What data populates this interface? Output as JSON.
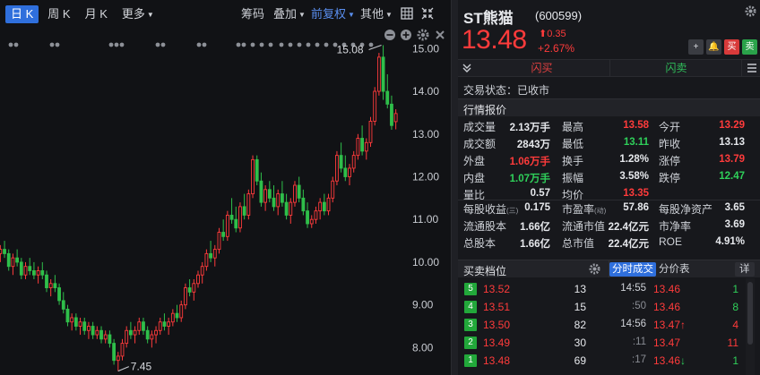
{
  "toolbar": {
    "periods": [
      {
        "label": "日 K",
        "active": true
      },
      {
        "label": "周 K",
        "active": false
      },
      {
        "label": "月 K",
        "active": false
      }
    ],
    "more": "更多",
    "chips": "筹码",
    "overlay": "叠加",
    "adjust": "前复权",
    "other": "其他",
    "icons": [
      "grid-icon",
      "collapse-icon"
    ]
  },
  "chart": {
    "price_axis": [
      "15.00",
      "14.00",
      "13.00",
      "12.00",
      "11.00",
      "10.00",
      "9.00",
      "8.00"
    ],
    "high_marker": "15.08",
    "low_marker": "7.45",
    "colors": {
      "up": "#ff3b3b",
      "down": "#2fbf4a",
      "bg": "#111215"
    },
    "controls": [
      "zoom-out-icon",
      "zoom-in-icon",
      "settings-icon",
      "close-icon"
    ]
  },
  "chart_data": {
    "type": "candlestick",
    "yrange": [
      7.4,
      15.3
    ],
    "y_ticks": [
      15.0,
      14.0,
      13.0,
      12.0,
      11.0,
      10.0,
      9.0,
      8.0
    ],
    "high": 15.08,
    "low": 7.45,
    "candles": [
      [
        10.2,
        10.4,
        10.0,
        10.3
      ],
      [
        10.3,
        10.5,
        10.1,
        10.2
      ],
      [
        10.2,
        10.3,
        9.8,
        9.9
      ],
      [
        9.9,
        10.2,
        9.7,
        10.1
      ],
      [
        10.1,
        10.3,
        9.9,
        10.0
      ],
      [
        10.0,
        10.1,
        9.6,
        9.7
      ],
      [
        9.7,
        10.0,
        9.6,
        9.9
      ],
      [
        9.9,
        10.1,
        9.7,
        9.8
      ],
      [
        9.8,
        10.0,
        9.6,
        9.7
      ],
      [
        9.7,
        9.9,
        9.5,
        9.8
      ],
      [
        9.8,
        10.0,
        9.6,
        9.7
      ],
      [
        9.7,
        9.8,
        9.3,
        9.4
      ],
      [
        9.4,
        9.6,
        9.2,
        9.5
      ],
      [
        9.5,
        9.7,
        9.3,
        9.4
      ],
      [
        9.4,
        9.5,
        9.0,
        9.1
      ],
      [
        9.1,
        9.3,
        8.8,
        8.9
      ],
      [
        8.9,
        9.0,
        8.5,
        8.6
      ],
      [
        8.6,
        8.8,
        8.4,
        8.7
      ],
      [
        8.7,
        8.8,
        8.4,
        8.5
      ],
      [
        8.5,
        8.7,
        8.3,
        8.6
      ],
      [
        8.6,
        8.7,
        8.3,
        8.4
      ],
      [
        8.4,
        8.6,
        8.2,
        8.5
      ],
      [
        8.5,
        8.6,
        8.2,
        8.3
      ],
      [
        8.3,
        8.5,
        8.2,
        8.4
      ],
      [
        8.4,
        8.5,
        8.1,
        8.2
      ],
      [
        8.2,
        8.4,
        8.1,
        8.3
      ],
      [
        8.3,
        8.4,
        8.0,
        8.1
      ],
      [
        8.1,
        8.2,
        7.6,
        7.7
      ],
      [
        7.7,
        7.9,
        7.45,
        7.8
      ],
      [
        7.8,
        8.2,
        7.7,
        8.1
      ],
      [
        8.1,
        8.5,
        8.0,
        8.4
      ],
      [
        8.4,
        8.6,
        8.2,
        8.3
      ],
      [
        8.3,
        8.5,
        8.1,
        8.4
      ],
      [
        8.4,
        8.7,
        8.3,
        8.6
      ],
      [
        8.6,
        8.7,
        8.3,
        8.4
      ],
      [
        8.4,
        8.5,
        8.1,
        8.2
      ],
      [
        8.2,
        8.4,
        8.0,
        8.3
      ],
      [
        8.3,
        8.5,
        8.1,
        8.4
      ],
      [
        8.4,
        8.7,
        8.3,
        8.6
      ],
      [
        8.6,
        8.8,
        8.4,
        8.5
      ],
      [
        8.5,
        8.7,
        8.3,
        8.6
      ],
      [
        8.6,
        8.9,
        8.5,
        8.8
      ],
      [
        8.8,
        9.0,
        8.6,
        8.7
      ],
      [
        8.7,
        9.1,
        8.6,
        9.0
      ],
      [
        9.0,
        9.5,
        8.9,
        9.4
      ],
      [
        9.4,
        9.6,
        9.2,
        9.3
      ],
      [
        9.3,
        9.6,
        9.1,
        9.5
      ],
      [
        9.5,
        9.8,
        9.4,
        9.7
      ],
      [
        9.7,
        10.0,
        9.5,
        9.9
      ],
      [
        9.9,
        10.3,
        9.8,
        10.2
      ],
      [
        10.2,
        10.5,
        10.0,
        10.1
      ],
      [
        10.1,
        10.4,
        9.9,
        10.3
      ],
      [
        10.3,
        10.8,
        10.2,
        10.7
      ],
      [
        10.7,
        11.0,
        10.5,
        10.6
      ],
      [
        10.6,
        11.2,
        10.5,
        11.1
      ],
      [
        11.1,
        11.5,
        10.9,
        11.0
      ],
      [
        11.0,
        11.3,
        10.7,
        10.8
      ],
      [
        10.8,
        11.4,
        10.7,
        11.3
      ],
      [
        11.3,
        11.6,
        11.0,
        11.1
      ],
      [
        11.1,
        11.7,
        11.0,
        11.6
      ],
      [
        11.6,
        12.5,
        11.5,
        12.4
      ],
      [
        12.4,
        12.5,
        11.8,
        11.9
      ],
      [
        11.9,
        12.1,
        11.3,
        11.4
      ],
      [
        11.4,
        11.8,
        11.2,
        11.7
      ],
      [
        11.7,
        11.9,
        11.4,
        11.5
      ],
      [
        11.5,
        11.8,
        11.2,
        11.3
      ],
      [
        11.3,
        11.7,
        11.1,
        11.6
      ],
      [
        11.6,
        11.9,
        11.3,
        11.4
      ],
      [
        11.4,
        11.6,
        11.0,
        11.1
      ],
      [
        11.1,
        11.5,
        10.9,
        11.4
      ],
      [
        11.4,
        11.9,
        11.3,
        11.8
      ],
      [
        11.8,
        12.0,
        11.4,
        11.5
      ],
      [
        11.5,
        11.7,
        11.1,
        11.2
      ],
      [
        11.2,
        11.4,
        10.8,
        10.9
      ],
      [
        10.9,
        11.1,
        10.8,
        11.0
      ],
      [
        11.0,
        11.3,
        10.9,
        11.2
      ],
      [
        11.2,
        11.5,
        11.0,
        11.4
      ],
      [
        11.4,
        11.6,
        11.1,
        11.2
      ],
      [
        11.2,
        11.6,
        11.1,
        11.5
      ],
      [
        11.5,
        12.0,
        11.4,
        11.9
      ],
      [
        11.9,
        12.6,
        11.8,
        12.5
      ],
      [
        12.5,
        12.8,
        12.1,
        12.2
      ],
      [
        12.2,
        12.5,
        11.9,
        12.0
      ],
      [
        12.0,
        12.3,
        11.8,
        12.2
      ],
      [
        12.2,
        12.6,
        12.1,
        12.5
      ],
      [
        12.5,
        13.0,
        12.4,
        12.9
      ],
      [
        12.9,
        13.2,
        12.5,
        12.6
      ],
      [
        12.6,
        12.9,
        12.4,
        12.8
      ],
      [
        12.8,
        13.4,
        12.7,
        13.3
      ],
      [
        13.3,
        14.1,
        13.2,
        14.0
      ],
      [
        14.0,
        14.9,
        13.9,
        14.8
      ],
      [
        14.8,
        15.08,
        13.8,
        14.0
      ],
      [
        14.0,
        14.4,
        13.6,
        13.7
      ],
      [
        13.7,
        13.9,
        13.1,
        13.2
      ],
      [
        13.29,
        13.58,
        13.11,
        13.48
      ]
    ]
  },
  "quote": {
    "name": "ST熊猫",
    "code": "(600599)",
    "price": "13.48",
    "change_abs": "0.35",
    "change_arrow": "⬆",
    "change_pct": "+2.67%",
    "actions": [
      "+",
      "🔔",
      "买",
      "卖"
    ],
    "quick_buy": "闪买",
    "quick_sell": "闪卖",
    "status": "交易状态：已收市",
    "section_title": "行情报价",
    "rows": [
      [
        {
          "label": "成交量",
          "value": "2.13万手",
          "c": ""
        },
        {
          "label": "最高",
          "value": "13.58",
          "c": "red"
        },
        {
          "label": "今开",
          "value": "13.29",
          "c": "red"
        }
      ],
      [
        {
          "label": "成交额",
          "value": "2843万",
          "c": ""
        },
        {
          "label": "最低",
          "value": "13.11",
          "c": "green"
        },
        {
          "label": "昨收",
          "value": "13.13",
          "c": ""
        }
      ],
      [
        {
          "label": "外盘",
          "value": "1.06万手",
          "c": "red"
        },
        {
          "label": "换手",
          "value": "1.28%",
          "c": ""
        },
        {
          "label": "涨停",
          "value": "13.79",
          "c": "red"
        }
      ],
      [
        {
          "label": "内盘",
          "value": "1.07万手",
          "c": "green"
        },
        {
          "label": "振幅",
          "value": "3.58%",
          "c": ""
        },
        {
          "label": "跌停",
          "value": "12.47",
          "c": "green"
        }
      ],
      [
        {
          "label": "量比",
          "value": "0.57",
          "c": ""
        },
        {
          "label": "均价",
          "value": "13.35",
          "c": "red"
        }
      ]
    ],
    "rows2": [
      [
        {
          "label": "每股收益",
          "sub": "(三)",
          "value": "0.175",
          "c": ""
        },
        {
          "label": "市盈率",
          "sub": "(动)",
          "value": "57.86",
          "c": ""
        },
        {
          "label": "每股净资产",
          "sub": "",
          "value": "3.65",
          "c": ""
        }
      ],
      [
        {
          "label": "流通股本",
          "sub": "",
          "value": "1.66亿",
          "c": ""
        },
        {
          "label": "流通市值",
          "sub": "",
          "value": "22.4亿元",
          "c": ""
        },
        {
          "label": "市净率",
          "sub": "",
          "value": "3.69",
          "c": ""
        }
      ],
      [
        {
          "label": "总股本",
          "sub": "",
          "value": "1.66亿",
          "c": ""
        },
        {
          "label": "总市值",
          "sub": "",
          "value": "22.4亿元",
          "c": ""
        },
        {
          "label": "ROE",
          "sub": "",
          "value": "4.91%",
          "c": ""
        }
      ]
    ]
  },
  "orderbook": {
    "title": "买卖档位",
    "bids": [
      {
        "level": "5",
        "price": "13.52",
        "vol": "13"
      },
      {
        "level": "4",
        "price": "13.51",
        "vol": "15"
      },
      {
        "level": "3",
        "price": "13.50",
        "vol": "82"
      },
      {
        "level": "2",
        "price": "13.49",
        "vol": "30"
      },
      {
        "level": "1",
        "price": "13.48",
        "vol": "69"
      }
    ]
  },
  "ticks": {
    "tab_active": "分时成交",
    "tab_other": "分价表",
    "detail": "详",
    "rows": [
      {
        "time": "14:55",
        "dim": false,
        "price": "13.46",
        "arrow": "",
        "vol": "1",
        "c": "green"
      },
      {
        "time": ":50",
        "dim": true,
        "price": "13.46",
        "arrow": "",
        "vol": "8",
        "c": "green"
      },
      {
        "time": "14:56",
        "dim": false,
        "price": "13.47",
        "arrow": "↑",
        "vol": "4",
        "c": "red"
      },
      {
        "time": ":11",
        "dim": true,
        "price": "13.47",
        "arrow": "",
        "vol": "11",
        "c": "red"
      },
      {
        "time": ":17",
        "dim": true,
        "price": "13.46",
        "arrow": "↓",
        "vol": "1",
        "c": "green"
      }
    ]
  }
}
